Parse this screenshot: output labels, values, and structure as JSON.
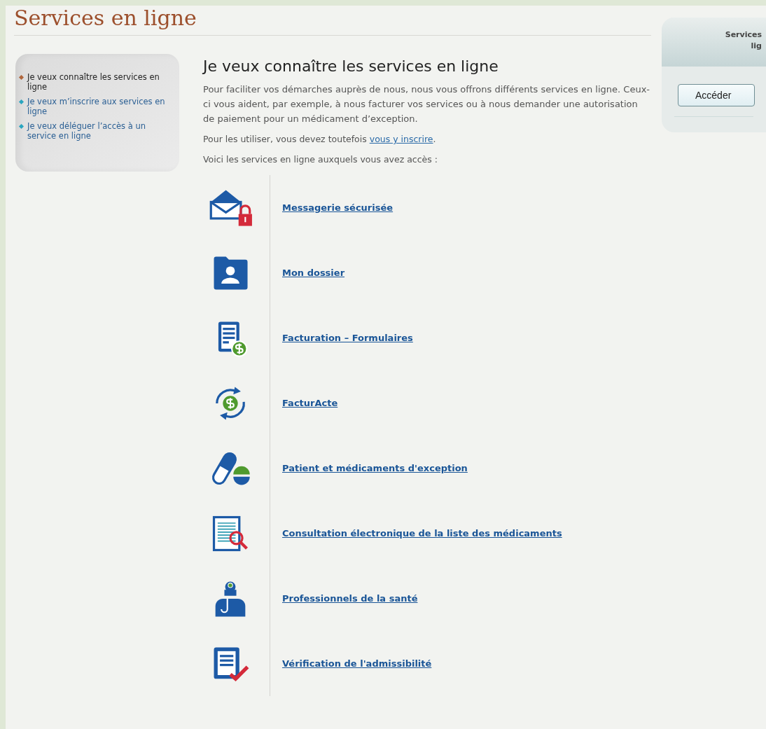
{
  "page_title": "Services en ligne",
  "sidebar": {
    "items": [
      {
        "label": "Je veux connaître les services en ligne",
        "selected": true
      },
      {
        "label": "Je veux m’inscrire aux services en ligne",
        "selected": false
      },
      {
        "label": "Je veux déléguer l’accès à un service en ligne",
        "selected": false
      }
    ]
  },
  "main": {
    "heading": "Je veux connaître les services en ligne",
    "intro": "Pour faciliter vos démarches auprès de nous, nous vous offrons différents services en ligne. Ceux-ci vous aident, par exemple, à nous facturer vos services ou à nous demander une autorisation de paiement pour un médicament d’exception.",
    "register_text": "Pour les utiliser, vous devez toutefois ",
    "register_link": "vous y inscrire",
    "register_end": ".",
    "list_intro": "Voici les services en ligne auxquels vous avez accès :",
    "services": [
      {
        "kind": "mail",
        "label": "Messagerie sécurisée "
      },
      {
        "kind": "folder",
        "label": "Mon dossier"
      },
      {
        "kind": "invoice",
        "label": "Facturation – Formulaires"
      },
      {
        "kind": "exchange",
        "label": "FacturActe"
      },
      {
        "kind": "pill",
        "label": "Patient et médicaments d'exception"
      },
      {
        "kind": "search",
        "label": "Consultation électronique de la liste des médicaments"
      },
      {
        "kind": "doctor",
        "label": "Professionnels de la santé"
      },
      {
        "kind": "check",
        "label": "Vérification de l'admissibilité"
      }
    ]
  },
  "access_widget": {
    "title_lines": [
      "Services",
      "lig"
    ],
    "button": "Accéder"
  }
}
